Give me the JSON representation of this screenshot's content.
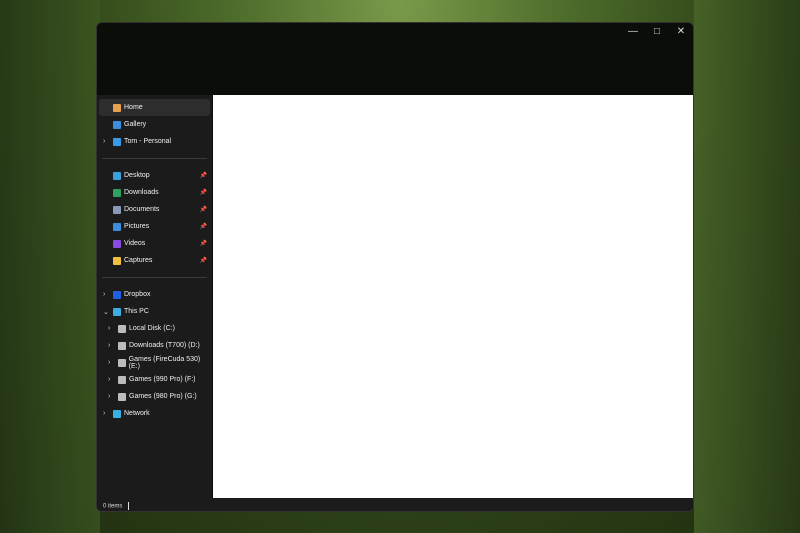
{
  "window": {
    "controls": [
      "minimize",
      "maximize",
      "close"
    ]
  },
  "sidebar": {
    "quick": [
      {
        "label": "Home",
        "icon": "home-icon",
        "color": "#e8a050",
        "selected": true
      },
      {
        "label": "Gallery",
        "icon": "gallery-icon",
        "color": "#3a8ee0"
      },
      {
        "label": "Tom - Personal",
        "icon": "onedrive-icon",
        "color": "#3a9ae8"
      }
    ],
    "pinned": [
      {
        "label": "Desktop",
        "icon": "desktop-icon",
        "color": "#3aa0e0"
      },
      {
        "label": "Downloads",
        "icon": "downloads-icon",
        "color": "#2ea060"
      },
      {
        "label": "Documents",
        "icon": "documents-icon",
        "color": "#8898b8"
      },
      {
        "label": "Pictures",
        "icon": "pictures-icon",
        "color": "#3a8ee0"
      },
      {
        "label": "Videos",
        "icon": "videos-icon",
        "color": "#8a4ae0"
      },
      {
        "label": "Captures",
        "icon": "folder-icon",
        "color": "#f0c040"
      }
    ],
    "tree": [
      {
        "label": "Dropbox",
        "icon": "dropbox-icon",
        "color": "#2060e0"
      },
      {
        "label": "This PC",
        "icon": "pc-icon",
        "color": "#3ab0e0"
      },
      {
        "label": "Local Disk (C:)",
        "icon": "drive-icon",
        "color": "#bbbbbb"
      },
      {
        "label": "Downloads (T700) (D:)",
        "icon": "drive-icon",
        "color": "#bbbbbb"
      },
      {
        "label": "Games (FireCuda 530) (E:)",
        "icon": "drive-icon",
        "color": "#bbbbbb"
      },
      {
        "label": "Games (990 Pro) (F:)",
        "icon": "drive-icon",
        "color": "#bbbbbb"
      },
      {
        "label": "Games (980 Pro) (G:)",
        "icon": "drive-icon",
        "color": "#bbbbbb"
      },
      {
        "label": "Network",
        "icon": "network-icon",
        "color": "#3ab0e0"
      }
    ]
  },
  "status": {
    "items": "0 items"
  }
}
